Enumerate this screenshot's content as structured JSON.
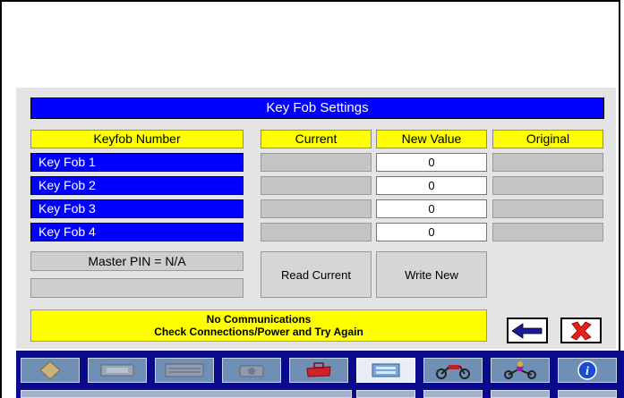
{
  "screen": {
    "title": "Key Fob Settings",
    "headers": {
      "keyfob": "Keyfob Number",
      "current": "Current",
      "new_value": "New Value",
      "original": "Original"
    },
    "rows": [
      {
        "label": "Key Fob 1",
        "current": "",
        "new_value": "0",
        "original": ""
      },
      {
        "label": "Key Fob 2",
        "current": "",
        "new_value": "0",
        "original": ""
      },
      {
        "label": "Key Fob 3",
        "current": "",
        "new_value": "0",
        "original": ""
      },
      {
        "label": "Key Fob 4",
        "current": "",
        "new_value": "0",
        "original": ""
      }
    ],
    "master_pin": "Master PIN = N/A",
    "buttons": {
      "read_current": "Read Current",
      "write_new": "Write New"
    },
    "status": {
      "line1": "No Communications",
      "line2": "Check Connections/Power and Try Again"
    },
    "nav": {
      "back_icon": "left-arrow-icon",
      "close_icon": "red-x-icon"
    }
  },
  "colors": {
    "title_bg": "#0000ff",
    "header_bg": "#ffff00",
    "row_bg": "#0000ff",
    "status_bg": "#ffff00",
    "taskbar_bg": "#0a0a8a",
    "close_red": "#e8201a"
  },
  "taskbar": {
    "items": [
      {
        "icon": "diamond-sign-icon",
        "active": false
      },
      {
        "icon": "device-module-icon",
        "active": false
      },
      {
        "icon": "keyboard-panel-icon",
        "active": false
      },
      {
        "icon": "camera-icon",
        "active": false
      },
      {
        "icon": "toolbox-icon",
        "active": false
      },
      {
        "icon": "screen-panel-icon",
        "active": true
      },
      {
        "icon": "motorcycle-icon",
        "active": false
      },
      {
        "icon": "motorcycle-rider-icon",
        "active": false
      },
      {
        "icon": "info-icon",
        "active": false
      }
    ]
  }
}
